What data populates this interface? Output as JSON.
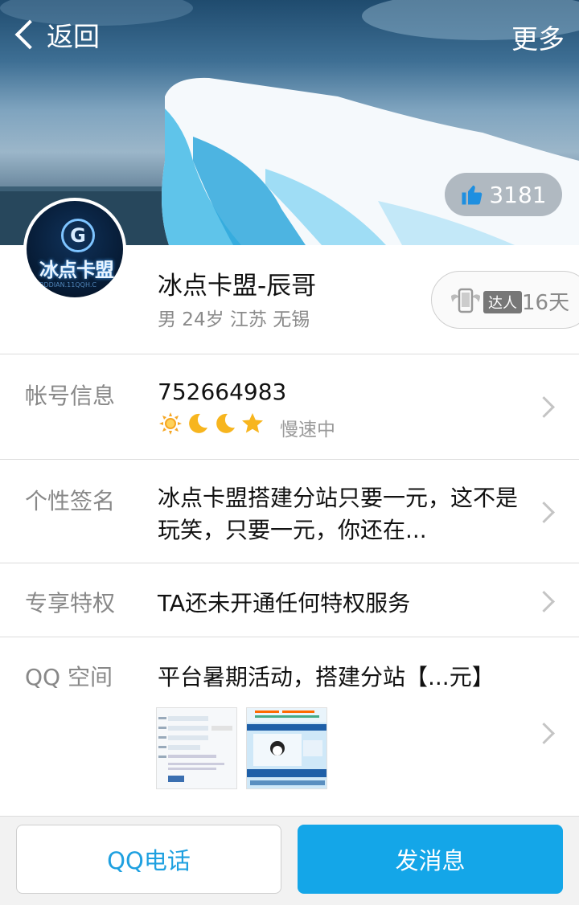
{
  "nav": {
    "back_label": "返回",
    "more_label": "更多"
  },
  "cover": {
    "likes": "3181"
  },
  "profile": {
    "avatar_text": "冰点卡盟",
    "avatar_letter": "G",
    "avatar_url": "BDDIAN.11QQH.C",
    "nickname": "冰点卡盟-辰哥",
    "meta": "男 24岁 江苏 无锡",
    "talent_badge": "达人",
    "talent_days": "16天"
  },
  "account": {
    "label": "帐号信息",
    "qq": "752664983",
    "speed": "慢速中",
    "level_icons": [
      "sun-icon",
      "moon-icon",
      "moon-icon",
      "star-icon"
    ]
  },
  "signature": {
    "label": "个性签名",
    "text": "冰点卡盟搭建分站只要一元，这不是玩笑，只要一元，你还在..."
  },
  "privilege": {
    "label": "专享特权",
    "text": "TA还未开通任何特权服务"
  },
  "qzone": {
    "label": "QQ 空间",
    "text": "平台暑期活动，搭建分站【...元】"
  },
  "actions": {
    "call_label": "QQ电话",
    "message_label": "发消息"
  },
  "colors": {
    "accent": "#14a6e8",
    "accent_text": "#1ea0e0"
  }
}
